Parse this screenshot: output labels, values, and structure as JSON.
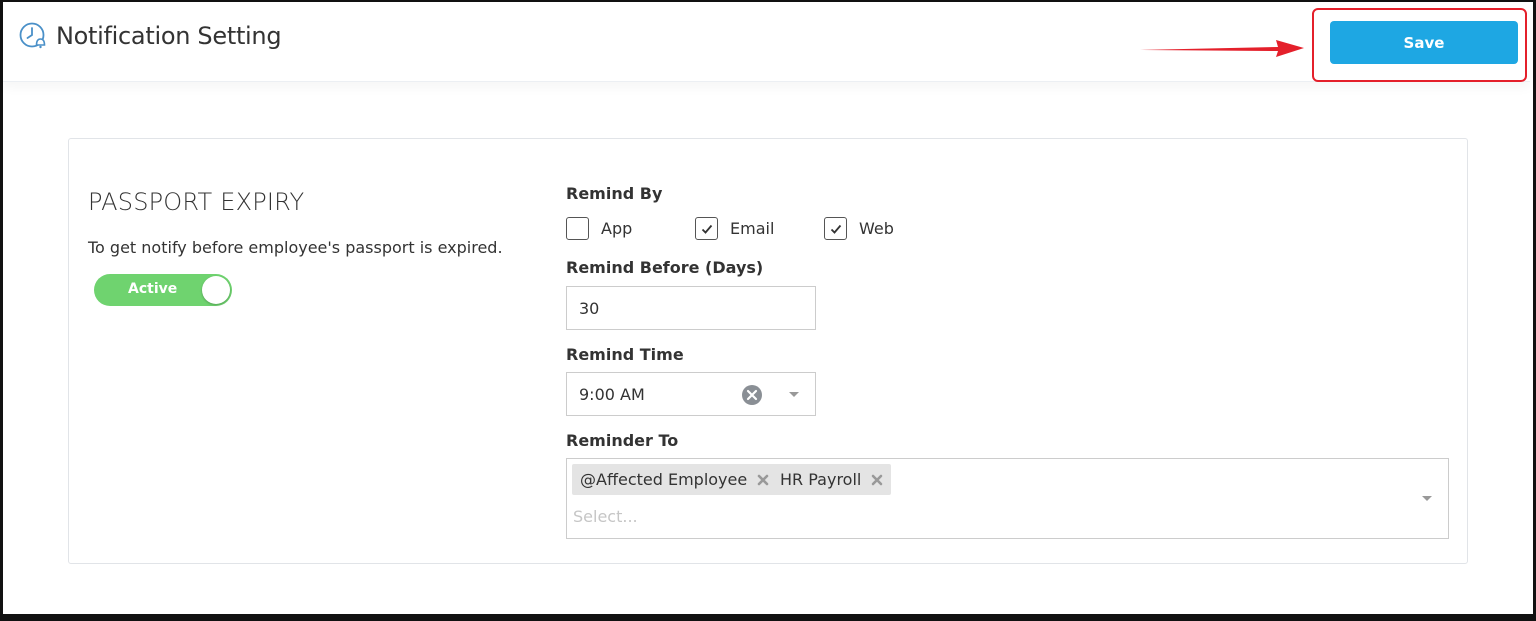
{
  "header": {
    "title": "Notification Setting",
    "icon": "clock-bell-icon",
    "save_label": "Save",
    "accent_color": "#1ea7e3",
    "highlight_color": "#e4202b"
  },
  "section": {
    "title": "PASSPORT EXPIRY",
    "description": "To get notify before employee's passport is expired.",
    "toggle_label": "Active",
    "toggle_color": "#6fd36f"
  },
  "form": {
    "remind_by_label": "Remind By",
    "channels": [
      {
        "label": "App",
        "checked": false
      },
      {
        "label": "Email",
        "checked": true
      },
      {
        "label": "Web",
        "checked": true
      }
    ],
    "remind_before_label": "Remind Before (Days)",
    "remind_before_value": "30",
    "remind_time_label": "Remind Time",
    "remind_time_value": "9:00 AM",
    "reminder_to_label": "Reminder To",
    "recipients": [
      "@Affected Employee",
      "HR Payroll"
    ],
    "recipients_placeholder": "Select..."
  }
}
